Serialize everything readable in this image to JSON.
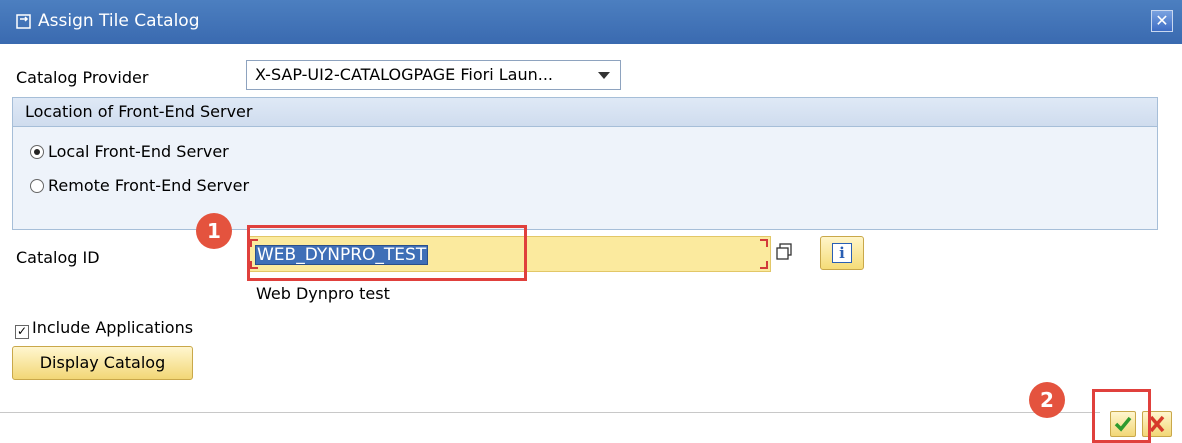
{
  "dialog": {
    "title": "Assign Tile Catalog",
    "close_glyph": "✕"
  },
  "provider": {
    "label": "Catalog Provider",
    "value": "X-SAP-UI2-CATALOGPAGE Fiori Laun..."
  },
  "location_group": {
    "header": "Location of Front-End Server",
    "options": [
      {
        "label": "Local Front-End Server",
        "selected": true
      },
      {
        "label": "Remote Front-End Server",
        "selected": false
      }
    ]
  },
  "catalog": {
    "label": "Catalog ID",
    "value": "WEB_DYNPRO_TEST",
    "description": "Web Dynpro test",
    "info_glyph": "i"
  },
  "include_applications": {
    "label": "Include Applications",
    "checked": true,
    "check_glyph": "✓"
  },
  "display_button": {
    "label": "Display Catalog"
  },
  "footer": {
    "ok_icon": "green-check-icon",
    "cancel_icon": "red-cross-icon"
  },
  "annotations": {
    "badge_1": "1",
    "badge_2": "2",
    "color": "#e0403c"
  },
  "colors": {
    "title_bar": "#3f70b6",
    "input_highlight": "#fbea9e",
    "button_yellow": "#f2d776"
  }
}
